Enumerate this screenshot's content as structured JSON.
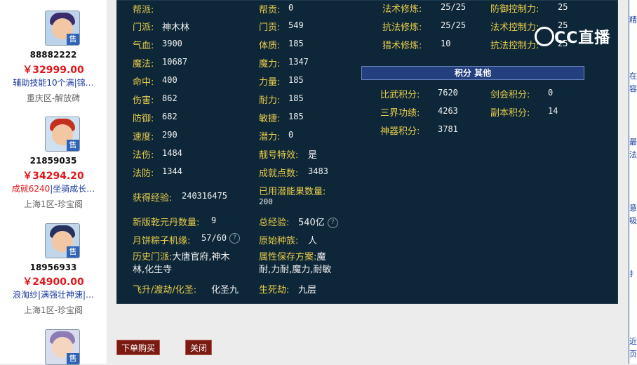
{
  "listings": [
    {
      "id": "88882222",
      "price": "￥32999.00",
      "desc": "辅助技能10个满|锦…",
      "desc_red": "",
      "server": "重庆区-解放碑",
      "sale": "售",
      "avatar_color": "#3a2b6b",
      "skin": "#f2c7a4"
    },
    {
      "id": "21859035",
      "price": "￥34294.20",
      "desc": "|坐骑成长…",
      "desc_red": "成就6240",
      "server": "上海1区-珍宝阁",
      "sale": "售",
      "avatar_color": "#c4301f",
      "skin": "#f2c7a4"
    },
    {
      "id": "18956933",
      "price": "￥24900.00",
      "desc": "浪淘纱|满强壮神速|…",
      "desc_red": "",
      "server": "上海1区-珍宝阁",
      "sale": "售",
      "avatar_color": "#26315e",
      "skin": "#f2c7a4"
    },
    {
      "id": "",
      "price": "",
      "desc": "",
      "desc_red": "",
      "server": "",
      "sale": "售",
      "avatar_color": "#8d7bb5",
      "skin": "#f4d6c0"
    }
  ],
  "stats_col1": [
    {
      "label": "帮派:",
      "value": ""
    },
    {
      "label": "门派:",
      "value": "神木林"
    },
    {
      "label": "气血:",
      "value": "3900"
    },
    {
      "label": "魔法:",
      "value": "10687"
    },
    {
      "label": "命中:",
      "value": "400"
    },
    {
      "label": "伤害:",
      "value": "862"
    },
    {
      "label": "防御:",
      "value": "682"
    },
    {
      "label": "速度:",
      "value": "290"
    },
    {
      "label": "法伤:",
      "value": "1484"
    },
    {
      "label": "法防:",
      "value": "1344"
    }
  ],
  "stats_col2": [
    {
      "label": "帮贡:",
      "value": "0"
    },
    {
      "label": "门贡:",
      "value": "549"
    },
    {
      "label": "体质:",
      "value": "185"
    },
    {
      "label": "魔力:",
      "value": "1347"
    },
    {
      "label": "力量:",
      "value": "185"
    },
    {
      "label": "耐力:",
      "value": "185"
    },
    {
      "label": "敏捷:",
      "value": "185"
    },
    {
      "label": "潜力:",
      "value": "0"
    },
    {
      "label": "靓号特效:",
      "value": "是"
    },
    {
      "label": "成就点数:",
      "value": "3483"
    }
  ],
  "extra": {
    "exp_label": "获得经验:",
    "exp_value": "240316475",
    "used_label": "已用潜能果数量:",
    "used_value": "200",
    "qyd_label": "新版乾元丹数量:",
    "qyd_value": "9",
    "total_label": "总经验:",
    "total_value": "540亿",
    "zz_label": "月饼粽子机缘:",
    "zz_value": "57/60",
    "race_label": "原始种族:",
    "race_value": "人",
    "hist_label": "历史门派:",
    "hist_value_1": "大唐官府,神木",
    "hist_value_2": "林,化生寺",
    "attr_label": "属性保存方案:",
    "attr_value_1": "魔",
    "attr_value_2": "耐,力耐,魔力,耐敏",
    "fly_label": "飞升/渡劫/化圣:",
    "fly_value": "化圣九",
    "sjj_label": "生死劫:",
    "sjj_value": "九层"
  },
  "cultivation": [
    {
      "label": "法术修炼:",
      "value": "25/25"
    },
    {
      "label": "抗法修炼:",
      "value": "25/25"
    },
    {
      "label": "猎术修炼:",
      "value": "10"
    }
  ],
  "control": [
    {
      "label": "防御控制力:",
      "value": "25"
    },
    {
      "label": "法术控制力:",
      "value": "25"
    },
    {
      "label": "抗法控制力:",
      "value": "25"
    }
  ],
  "section_title": "积分 其他",
  "scores_left": [
    {
      "label": "比武积分:",
      "value": "7620"
    },
    {
      "label": "三界功绩:",
      "value": "4263"
    },
    {
      "label": "神器积分:",
      "value": "3781"
    }
  ],
  "scores_right": [
    {
      "label": "剑会积分:",
      "value": "0"
    },
    {
      "label": "副本积分:",
      "value": "14"
    }
  ],
  "buttons": {
    "buy": "下单购买",
    "close": "关闭"
  },
  "watermark": "CC直播",
  "right_strip": [
    "精",
    "在",
    "容",
    "最",
    "法",
    "意",
    "吸",
    "扌",
    "近",
    "页"
  ],
  "colors": {
    "panel": "#0e2738",
    "label": "#e8cc4a",
    "price": "#e0161b",
    "button": "#7a1a12",
    "section": "#233f7d"
  }
}
